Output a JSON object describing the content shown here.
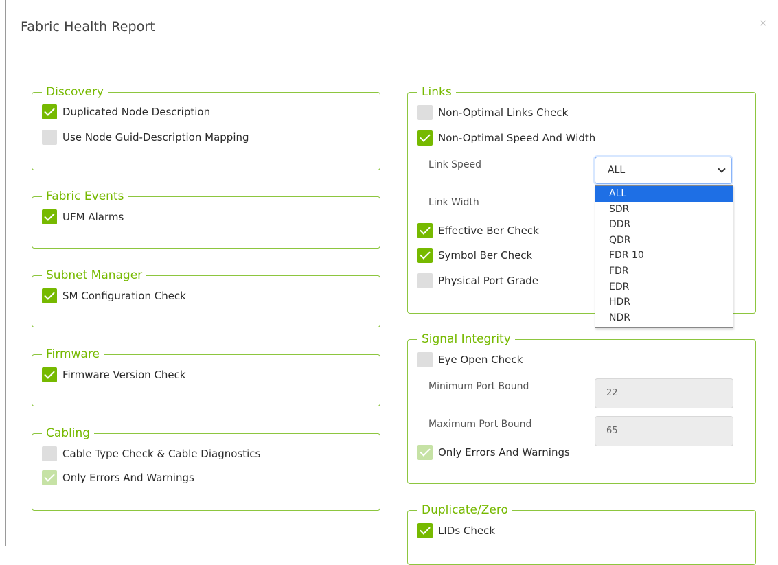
{
  "dialog": {
    "title": "Fabric Health Report",
    "close_icon": "×"
  },
  "discovery": {
    "legend": "Discovery",
    "items": [
      {
        "label": "Duplicated Node Description",
        "state": "checked"
      },
      {
        "label": "Use Node Guid-Description Mapping",
        "state": "unchecked"
      }
    ]
  },
  "fabric_events": {
    "legend": "Fabric Events",
    "items": [
      {
        "label": "UFM Alarms",
        "state": "checked"
      }
    ]
  },
  "subnet_manager": {
    "legend": "Subnet Manager",
    "items": [
      {
        "label": "SM Configuration Check",
        "state": "checked"
      }
    ]
  },
  "firmware": {
    "legend": "Firmware",
    "items": [
      {
        "label": "Firmware Version Check",
        "state": "checked"
      }
    ]
  },
  "cabling": {
    "legend": "Cabling",
    "items": [
      {
        "label": "Cable Type Check & Cable Diagnostics",
        "state": "unchecked"
      },
      {
        "label": "Only Errors And Warnings",
        "state": "checked-disabled"
      }
    ]
  },
  "links": {
    "legend": "Links",
    "items": [
      {
        "label": "Non-Optimal Links Check",
        "state": "unchecked"
      },
      {
        "label": "Non-Optimal Speed And Width",
        "state": "checked"
      },
      {
        "label": "Effective Ber Check",
        "state": "checked"
      },
      {
        "label": "Symbol Ber Check",
        "state": "checked"
      },
      {
        "label": "Physical Port Grade",
        "state": "unchecked"
      }
    ],
    "link_speed_label": "Link Speed",
    "link_speed_value": "ALL",
    "link_width_label": "Link Width",
    "speed_options": [
      "ALL",
      "SDR",
      "DDR",
      "QDR",
      "FDR 10",
      "FDR",
      "EDR",
      "HDR",
      "NDR"
    ]
  },
  "signal_integrity": {
    "legend": "Signal Integrity",
    "items": [
      {
        "label": "Eye Open Check",
        "state": "unchecked"
      },
      {
        "label": "Only Errors And Warnings",
        "state": "checked-disabled"
      }
    ],
    "min_port_bound_label": "Minimum Port Bound",
    "min_port_bound_value": "22",
    "max_port_bound_label": "Maximum Port Bound",
    "max_port_bound_value": "65"
  },
  "duplicate_zero": {
    "legend": "Duplicate/Zero",
    "items": [
      {
        "label": "LIDs Check",
        "state": "checked"
      }
    ]
  },
  "colors": {
    "accent": "#76b900",
    "border": "#8dc63f",
    "selected_option": "#1e6fe5"
  }
}
